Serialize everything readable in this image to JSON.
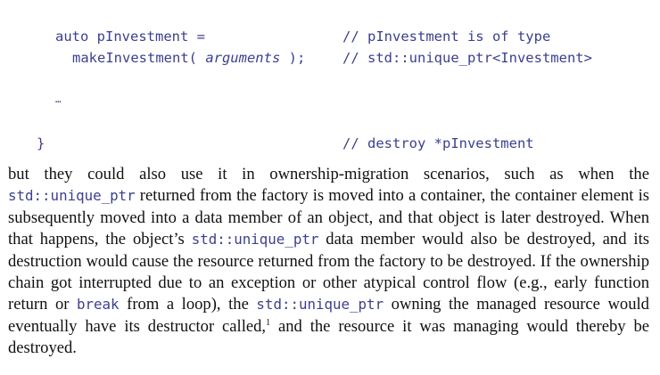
{
  "code": {
    "line1_left": "auto pInvestment =",
    "line1_comment": "// pInvestment is of type",
    "line2_call": "makeInvestment( ",
    "line2_args": "arguments",
    "line2_end": " );",
    "line2_comment": "// std::unique_ptr<Investment>",
    "ellipsis": "…",
    "close_brace": "}",
    "destroy_comment": "// destroy *pInvestment"
  },
  "paragraph": {
    "t1": "but they could also use it in ownership-migration scenarios, such as when the ",
    "c1": "std::unique_ptr",
    "t2": " returned from the factory is moved into a container, the container element is subsequently moved into a data member of an object, and that object is later destroyed. When that happens, the object’s ",
    "c2": "std::unique_ptr",
    "t3": " data member would also be destroyed, and its destruction would cause the resource returned from the factory to be destroyed. If the ownership chain got interrupted due to an excep­tion or other atypical control flow (e.g., early function return or ",
    "c3": "break",
    "t4": " from a loop), the ",
    "c4": "std::unique_ptr",
    "t5": " owning the managed resource would eventually have its destructor called,",
    "footnote_ref": "1",
    "t6": " and the resource it was managing would thereby be destroyed."
  }
}
